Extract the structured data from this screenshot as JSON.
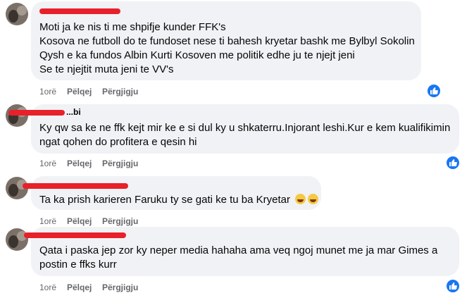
{
  "comments": [
    {
      "lines": [
        "Moti ja ke nis ti me shpifje kunder FFK's",
        "Kosova ne futboll do te fundoset nese ti bahesh kryetar bashk me Bylbyl Sokolin",
        "Qysh e ka fundos Albin Kurti Kosoven me politik edhe ju te njejt jeni",
        "Se te njejtit muta jeni te VV's"
      ],
      "time": "1orë",
      "like_label": "Pëlqej",
      "reply_label": "Përgjigju"
    },
    {
      "author_fragment": "...bi",
      "lines": [
        "Ky qw sa ke ne ffk kejt mir ke e si dul ky u shkaterru.Injorant leshi.Kur e kem kualifikimin",
        "ngat qohen do profitera e qesin hi"
      ],
      "time": "1orë",
      "like_label": "Pëlqej",
      "reply_label": "Përgjigju"
    },
    {
      "lines": [
        "Ta ka prish karieren Faruku ty se gati ke tu ba Kryetar"
      ],
      "emojis": [
        "grinning-face-emoji",
        "grinning-face-emoji"
      ],
      "time": "1orë",
      "like_label": "Pëlqej",
      "reply_label": "Përgjigju"
    },
    {
      "lines": [
        "Qata i paska jep zor ky neper media hahaha ama veq ngoj munet me ja mar Gimes a",
        "postin e ffks kurr"
      ],
      "time": "1orë",
      "like_label": "Pëlqej",
      "reply_label": "Përgjigju"
    }
  ],
  "colors": {
    "bubble": "#f0f2f5",
    "redaction": "#e8202a",
    "like_blue": "#1877f2",
    "meta_text": "#65676b"
  }
}
